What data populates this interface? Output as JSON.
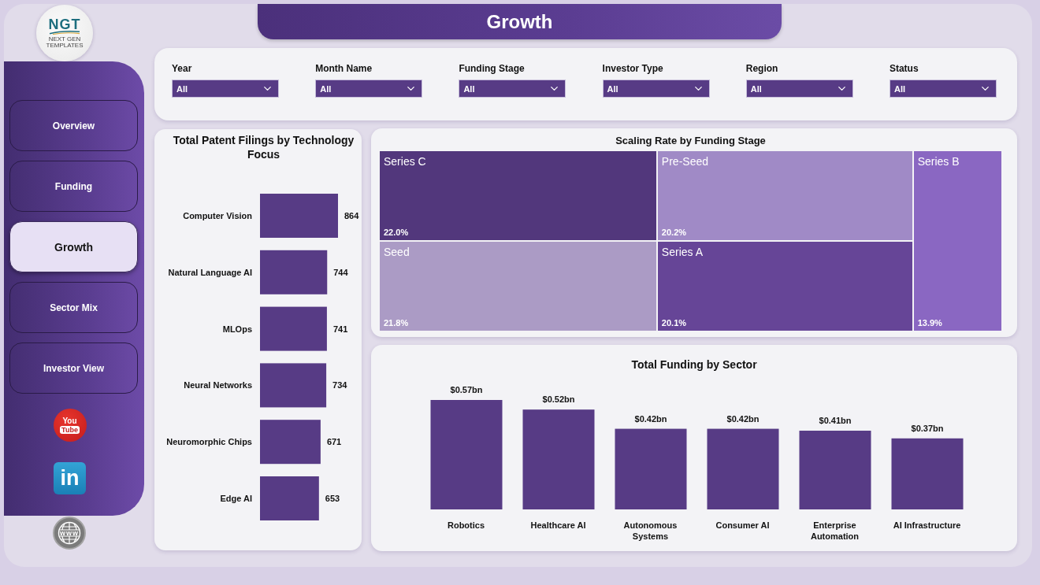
{
  "logo": {
    "text": "NGT",
    "tagline": "NEXT GEN TEMPLATES"
  },
  "page_title": "Growth",
  "sidebar": {
    "nav": [
      {
        "label": "Overview",
        "selected": false
      },
      {
        "label": "Funding",
        "selected": false
      },
      {
        "label": "Growth",
        "selected": true
      },
      {
        "label": "Sector Mix",
        "selected": false
      },
      {
        "label": "Investor View",
        "selected": false
      }
    ],
    "links": [
      {
        "kind": "youtube",
        "words": [
          "You",
          "Tube"
        ]
      },
      {
        "kind": "linkedin",
        "words": [
          "in"
        ]
      }
    ]
  },
  "footer_link": {
    "kind": "website",
    "words": [
      "www"
    ]
  },
  "filters": [
    {
      "label": "Year",
      "value": "All"
    },
    {
      "label": "Month Name",
      "value": "All"
    },
    {
      "label": "Funding Stage",
      "value": "All"
    },
    {
      "label": "Investor Type",
      "value": "All"
    },
    {
      "label": "Region",
      "value": "All"
    },
    {
      "label": "Status",
      "value": "All"
    }
  ],
  "patent_chart": {
    "chart_data": {
      "type": "bar",
      "orientation": "horizontal",
      "title": "Total Patent Filings by Technology Focus",
      "categories": [
        "Computer Vision",
        "Natural Language AI",
        "MLOps",
        "Neural Networks",
        "Neuromorphic Chips",
        "Edge AI"
      ],
      "values": [
        864,
        744,
        741,
        734,
        671,
        653
      ],
      "data_labels": true
    }
  },
  "treemap": {
    "title": "Scaling Rate by Funding Stage",
    "columns": [
      {
        "tiles": [
          {
            "stage": "Series C",
            "share": "22.0%",
            "color": "#52377c"
          },
          {
            "stage": "Seed",
            "share": "21.8%",
            "color": "#ab9bc5"
          }
        ]
      },
      {
        "tiles": [
          {
            "stage": "Pre-Seed",
            "share": "20.2%",
            "color": "#a08ac6"
          },
          {
            "stage": "Series A",
            "share": "20.1%",
            "color": "#664597"
          }
        ]
      },
      {
        "tiles": [
          {
            "stage": "Series B",
            "share": "13.9%",
            "color": "#8a67c2"
          }
        ]
      }
    ]
  },
  "sector_chart": {
    "chart_data": {
      "type": "bar",
      "title": "Total Funding by Sector",
      "categories": [
        "Robotics",
        "Healthcare AI",
        "Autonomous Systems",
        "Consumer AI",
        "Enterprise Automation",
        "AI Infrastructure"
      ],
      "values": [
        0.57,
        0.52,
        0.42,
        0.42,
        0.41,
        0.37
      ],
      "data_labels": true,
      "value_labels": [
        "$0.57bn",
        "$0.52bn",
        "$0.42bn",
        "$0.42bn",
        "$0.41bn",
        "$0.37bn"
      ]
    }
  }
}
